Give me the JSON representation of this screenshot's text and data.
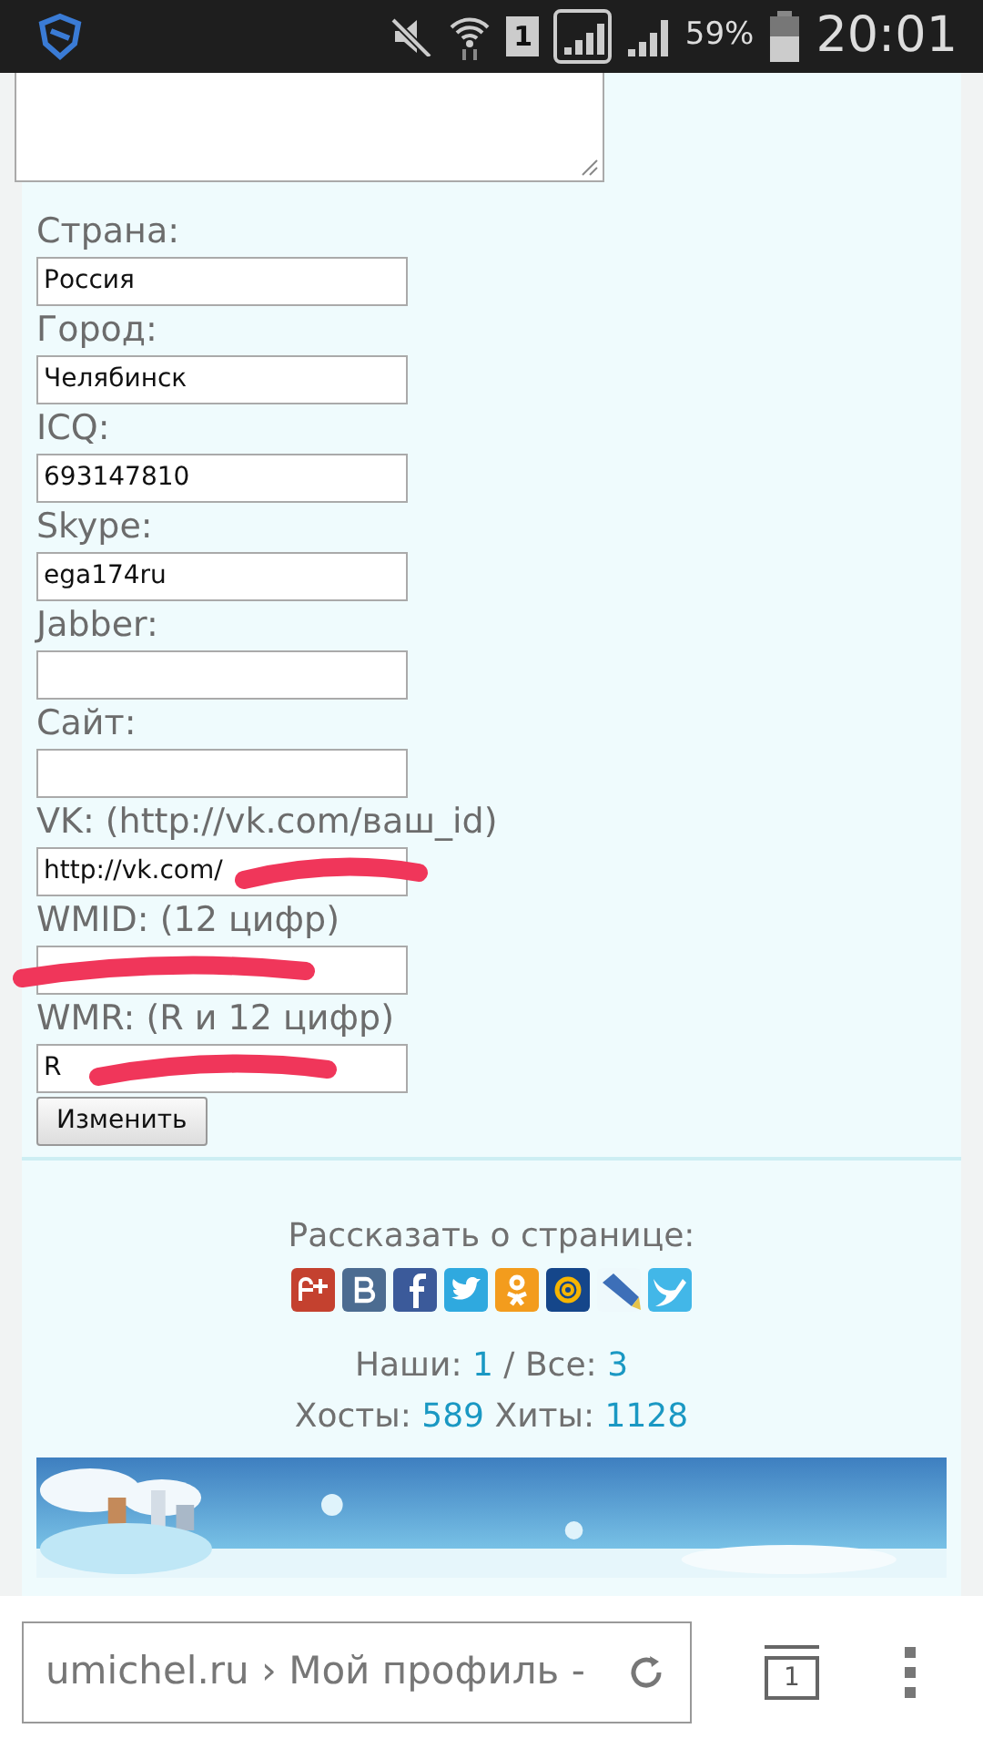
{
  "status_bar": {
    "sim_badge": "1",
    "battery": "59%",
    "time": "20:01"
  },
  "form": {
    "fields": [
      {
        "label": "Страна:",
        "value": "Россия",
        "scribbled": false
      },
      {
        "label": "Город:",
        "value": "Челябинск",
        "scribbled": false
      },
      {
        "label": "ICQ:",
        "value": "693147810",
        "scribbled": false
      },
      {
        "label": "Skype:",
        "value": "ega174ru",
        "scribbled": false
      },
      {
        "label": "Jabber:",
        "scribbled": false
      },
      {
        "label": "Сайт:",
        "scribbled": false
      },
      {
        "label": "VK: (http://vk.com/ваш_id)",
        "value": "http://vk.com/",
        "scribbled": true
      },
      {
        "label": "WMID: (12 цифр)",
        "scribbled": true
      },
      {
        "label": "WMR: (R и 12 цифр)",
        "value": "R",
        "scribbled": true
      }
    ],
    "button": "Изменить"
  },
  "share": {
    "title": "Рассказать о странице:"
  },
  "stats": {
    "ours_label": "Наши:",
    "ours": "1",
    "sep": "/",
    "all_label": "Все:",
    "all": "3",
    "hosts_label": "Хосты:",
    "hosts": "589",
    "hits_label": "Хиты:",
    "hits": "1128"
  },
  "browser": {
    "url": "umichel.ru › Мой профиль -",
    "tab_count": "1"
  }
}
